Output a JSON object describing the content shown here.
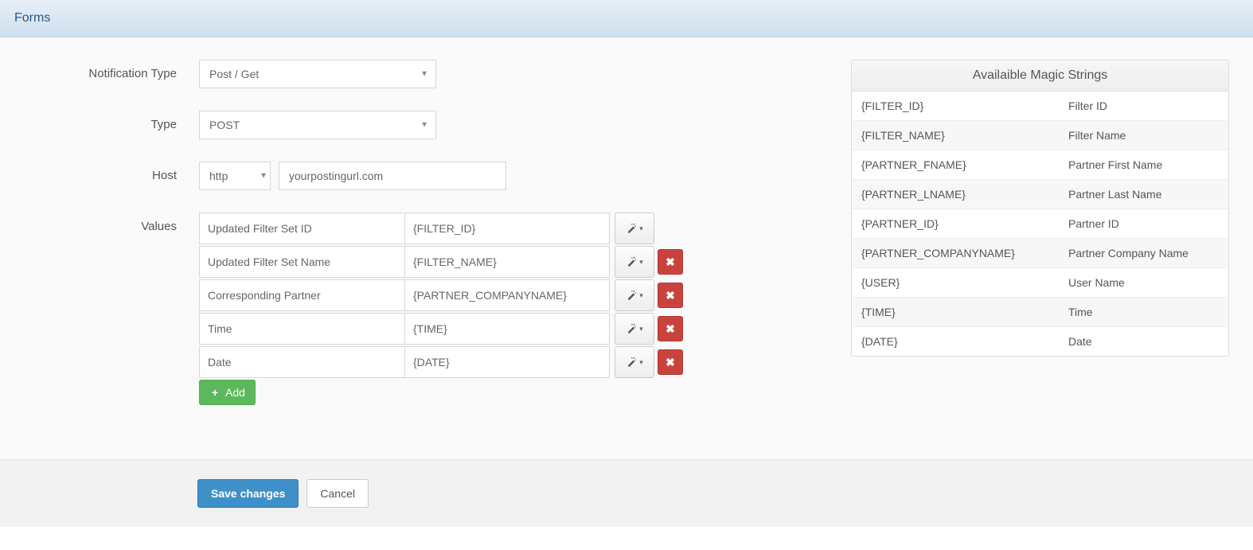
{
  "header": {
    "title": "Forms"
  },
  "form": {
    "labels": {
      "notification_type": "Notification Type",
      "type": "Type",
      "host": "Host",
      "values": "Values"
    },
    "notification_type": {
      "selected": "Post / Get"
    },
    "type": {
      "selected": "POST"
    },
    "host": {
      "protocol": "http",
      "url": "yourpostingurl.com"
    },
    "values_rows": [
      {
        "key": "Updated Filter Set ID",
        "value": "{FILTER_ID}",
        "has_delete": false
      },
      {
        "key": "Updated Filter Set Name",
        "value": "{FILTER_NAME}",
        "has_delete": true
      },
      {
        "key": "Corresponding Partner",
        "value": "{PARTNER_COMPANYNAME}",
        "has_delete": true
      },
      {
        "key": "Time",
        "value": "{TIME}",
        "has_delete": true
      },
      {
        "key": "Date",
        "value": "{DATE}",
        "has_delete": true
      }
    ],
    "add_label": "Add"
  },
  "magic": {
    "title": "Availaible Magic Strings",
    "rows": [
      {
        "key": "{FILTER_ID}",
        "desc": "Filter ID"
      },
      {
        "key": "{FILTER_NAME}",
        "desc": "Filter Name"
      },
      {
        "key": "{PARTNER_FNAME}",
        "desc": "Partner First Name"
      },
      {
        "key": "{PARTNER_LNAME}",
        "desc": "Partner Last Name"
      },
      {
        "key": "{PARTNER_ID}",
        "desc": "Partner ID"
      },
      {
        "key": "{PARTNER_COMPANYNAME}",
        "desc": "Partner Company Name"
      },
      {
        "key": "{USER}",
        "desc": "User Name"
      },
      {
        "key": "{TIME}",
        "desc": "Time"
      },
      {
        "key": "{DATE}",
        "desc": "Date"
      }
    ]
  },
  "footer": {
    "save_label": "Save changes",
    "cancel_label": "Cancel"
  }
}
